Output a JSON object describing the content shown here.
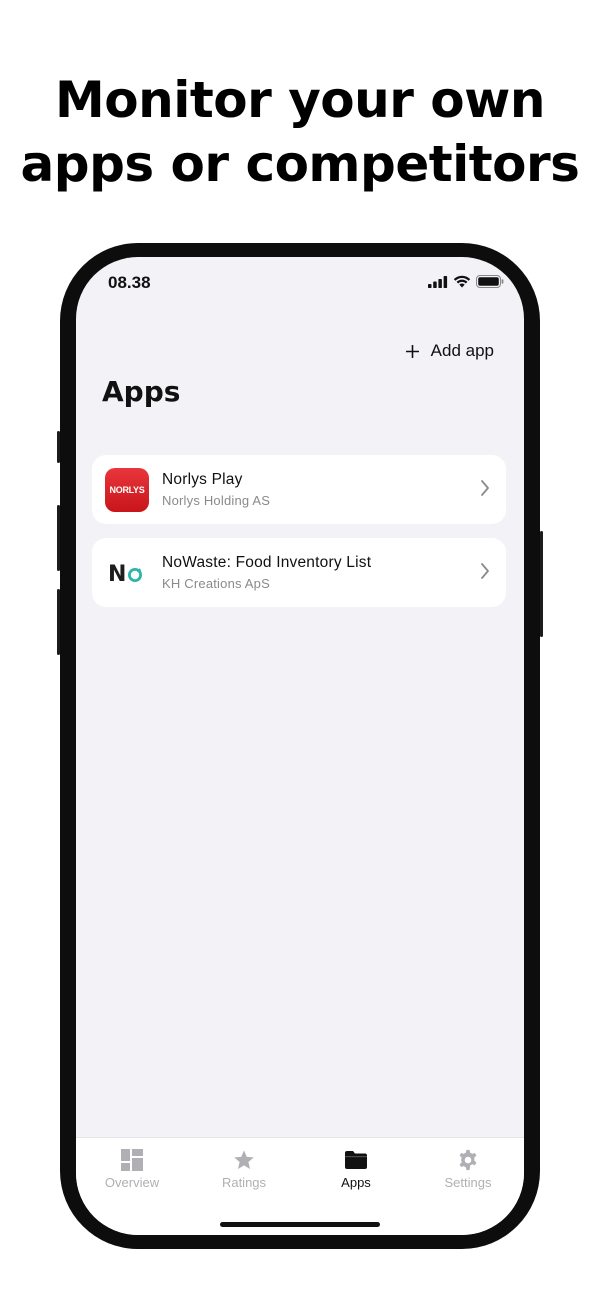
{
  "headline": {
    "line1": "Monitor your own",
    "line2": "apps or competitors"
  },
  "status_bar": {
    "time": "08.38",
    "icons": [
      "cellular-signal-icon",
      "wifi-icon",
      "battery-icon"
    ]
  },
  "header": {
    "add_app_icon": "plus-icon",
    "add_app_label": "Add app",
    "title": "Apps"
  },
  "apps": [
    {
      "name": "Norlys Play",
      "developer": "Norlys Holding AS",
      "icon_text": "NORLYS",
      "icon_color": "#d9252b"
    },
    {
      "name": "NoWaste: Food Inventory List",
      "developer": "KH Creations ApS",
      "icon_text": "No",
      "icon_color": "#2bb6a8"
    }
  ],
  "tabs": [
    {
      "label": "Overview",
      "icon": "dashboard-icon",
      "active": false
    },
    {
      "label": "Ratings",
      "icon": "star-icon",
      "active": false
    },
    {
      "label": "Apps",
      "icon": "folder-icon",
      "active": true
    },
    {
      "label": "Settings",
      "icon": "gear-icon",
      "active": false
    }
  ],
  "colors": {
    "screen_background": "#f2f2f7",
    "card_background": "#ffffff",
    "active_tab": "#111111",
    "inactive_tab": "#b0b0b4"
  }
}
